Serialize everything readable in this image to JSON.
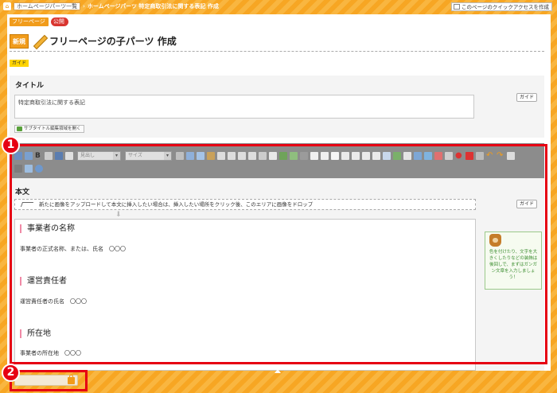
{
  "breadcrumb": {
    "items": [
      "ホームページパーツ一覧"
    ],
    "current": "ホームページパーツ 特定商取引法に関する表記 作成"
  },
  "quick_access_label": "このページのクイックアクセスを作成",
  "status": {
    "page_tag": "フリーページ",
    "public_tag": "公開"
  },
  "header": {
    "new_badge": "新規",
    "title": "フリーページの子パーツ 作成"
  },
  "guide_tag": "ガイド",
  "title_section": {
    "label": "タイトル",
    "value": "特定商取引法に関する表記",
    "guide_button": "ガイド",
    "subtitle_button": "サブタイトル編集領域を開く"
  },
  "toolbar": {
    "format_select": "見出し",
    "size_select": "サイズ"
  },
  "body_section": {
    "label": "本文",
    "drop_hint": "新たに画像をアップロードして本文に挿入したい場合は、挿入したい場所をクリック後、このエリアに画像をドロップ",
    "guide_button": "ガイド",
    "blocks": [
      {
        "heading": "事業者の名称",
        "text": "事業者の正式名称、または、氏名　〇〇〇"
      },
      {
        "heading": "運営責任者",
        "text": "運営責任者の氏名　〇〇〇"
      },
      {
        "heading": "所在地",
        "text": "事業者の所在地　〇〇〇"
      }
    ]
  },
  "hint": {
    "text": "色を付けたり、文字を大きくしたりなどの装飾は後回しで、まずはガンガン文章を入力しましょう！"
  },
  "callouts": [
    "1",
    "2"
  ],
  "colors": {
    "accent": "#f19c1b",
    "callout": "#e60012",
    "toolbar": "#8c8c8c"
  }
}
